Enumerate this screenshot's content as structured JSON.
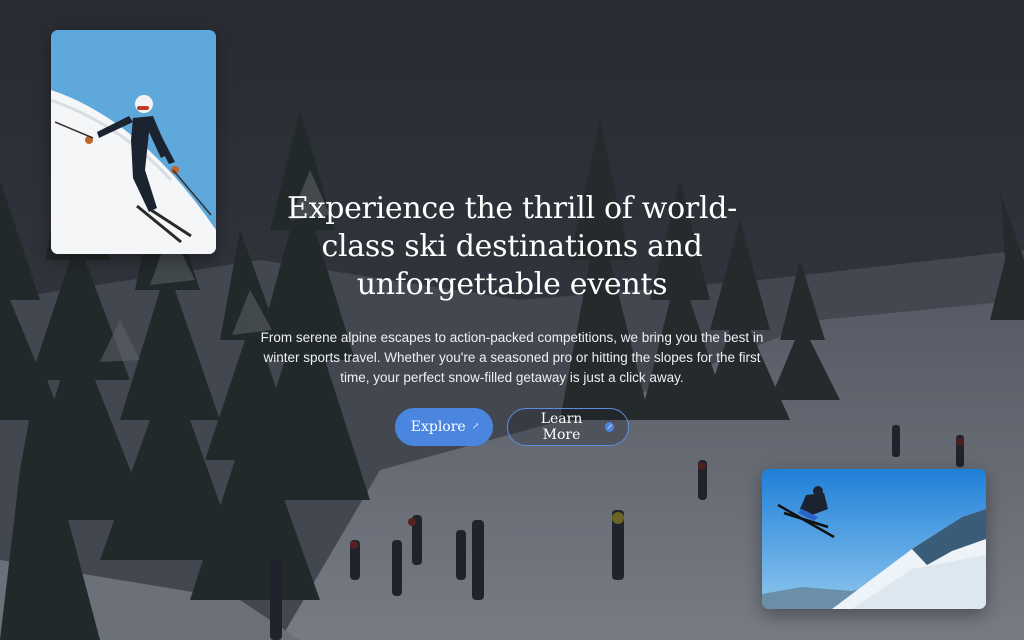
{
  "hero": {
    "headline": "Experience the thrill of world-class ski destinations and unforgettable events",
    "subtext": "From serene alpine escapes to action-packed competitions, we bring you the best in winter sports travel. Whether you're a seasoned pro or hitting the slopes for the first time, your perfect snow-filled getaway is just a click away."
  },
  "actions": {
    "explore_label": "Explore",
    "learn_more_label": "Learn More"
  },
  "icons": {
    "explore": "arrow-up-right-icon",
    "learn_more": "arrow-circle-icon"
  },
  "colors": {
    "accent": "#4a86e0",
    "overlay": "#14161c"
  }
}
